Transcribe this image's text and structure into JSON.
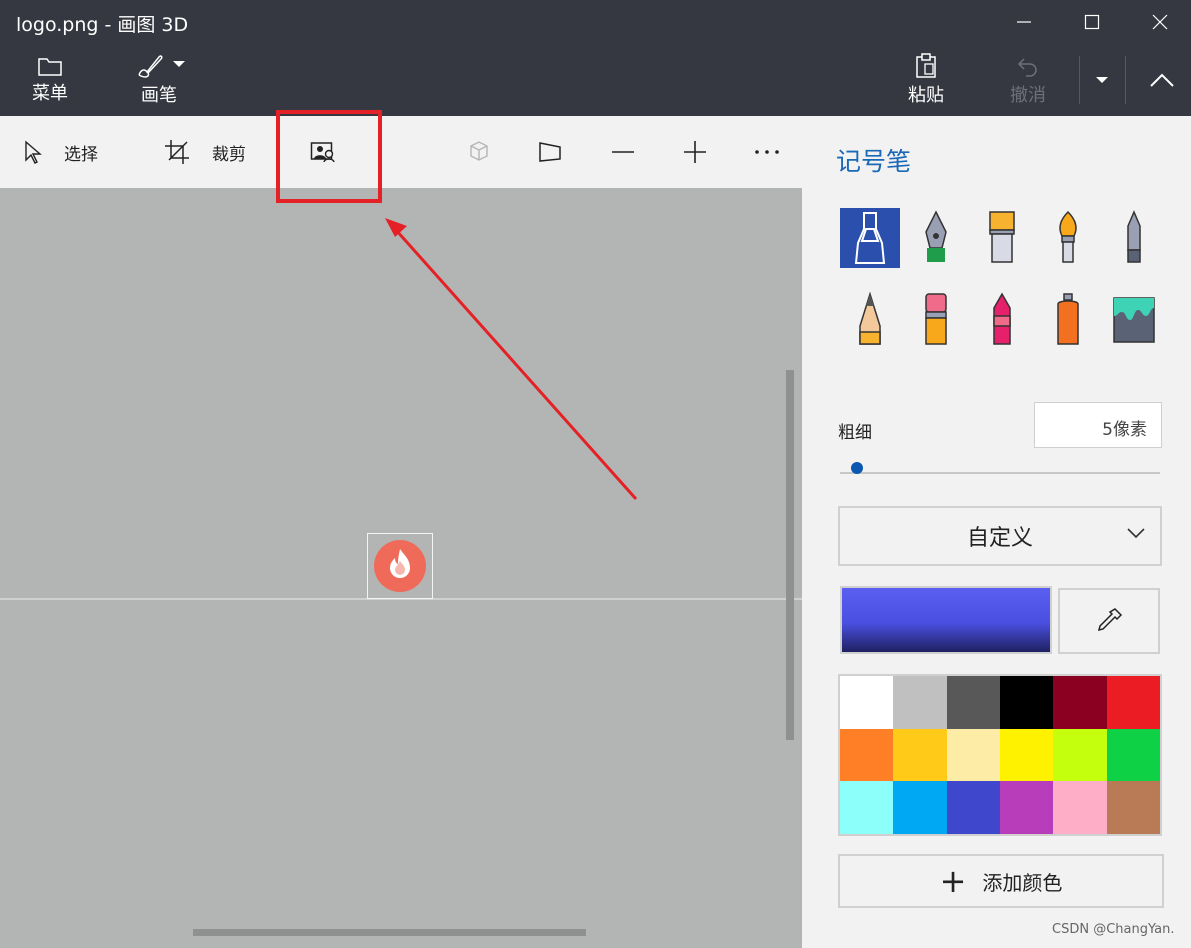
{
  "window": {
    "title": "logo.png - 画图 3D"
  },
  "ribbon": {
    "menu_label": "菜单",
    "brush_label": "画笔",
    "paste_label": "粘贴",
    "undo_label": "撤消"
  },
  "toolstrip": {
    "select_label": "选择",
    "crop_label": "裁剪"
  },
  "panel": {
    "title": "记号笔",
    "brushes": [
      "marker",
      "calligraphy-pen",
      "oil-brush",
      "watercolor",
      "pixel-pen",
      "pencil",
      "eraser",
      "crayon",
      "spraycan",
      "fill"
    ],
    "thickness_label": "粗细",
    "thickness_value": "5像素",
    "thickness_level": 0.05,
    "color_mode": "自定义",
    "current_color": "#4a4fe0",
    "palette": [
      "#ffffff",
      "#c0c0c0",
      "#585858",
      "#000000",
      "#8b0020",
      "#ec1c24",
      "#ff7f27",
      "#ffca18",
      "#fdeca6",
      "#fff200",
      "#c4ff0e",
      "#0ed145",
      "#8cfffb",
      "#00a8f3",
      "#3f48cc",
      "#b83dba",
      "#ffaec8",
      "#b97a56"
    ],
    "add_color_label": "添加颜色"
  },
  "watermark": "CSDN @ChangYan."
}
